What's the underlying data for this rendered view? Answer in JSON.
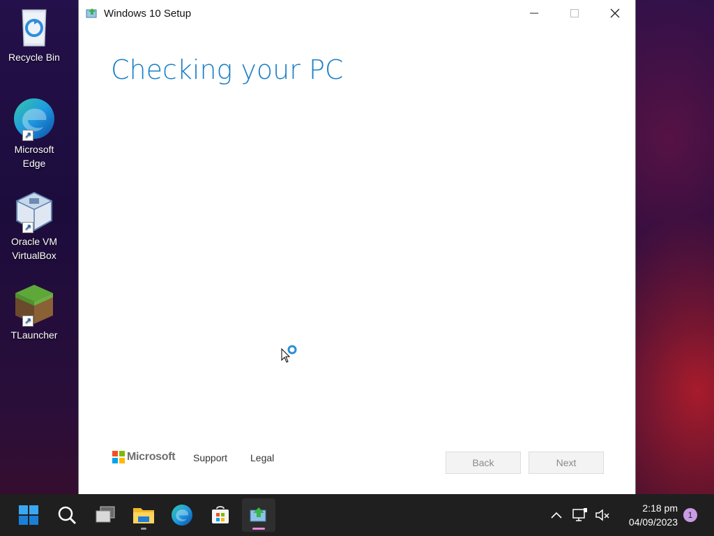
{
  "desktop": {
    "icons": [
      {
        "label": "Recycle Bin",
        "icon": "recycle-bin-icon"
      },
      {
        "label": "Microsoft Edge",
        "icon": "edge-icon"
      },
      {
        "label": "Oracle VM VirtualBox",
        "icon": "virtualbox-icon"
      },
      {
        "label": "TLauncher",
        "icon": "tlauncher-icon"
      }
    ]
  },
  "window": {
    "title": "Windows 10 Setup",
    "heading": "Checking your PC",
    "footer": {
      "brand": "Microsoft",
      "support_label": "Support",
      "legal_label": "Legal",
      "back_label": "Back",
      "next_label": "Next"
    }
  },
  "taskbar": {
    "apps": [
      "start-icon",
      "search-icon",
      "task-view-icon",
      "file-explorer-icon",
      "edge-icon",
      "store-icon",
      "setup-icon"
    ],
    "clock_time": "2:18 pm",
    "clock_date": "04/09/2023",
    "notification_count": "1"
  },
  "colors": {
    "heading_blue": "#1a7fc6",
    "taskbar": "#1f1f1f",
    "active_indicator": "#e68ad8"
  }
}
